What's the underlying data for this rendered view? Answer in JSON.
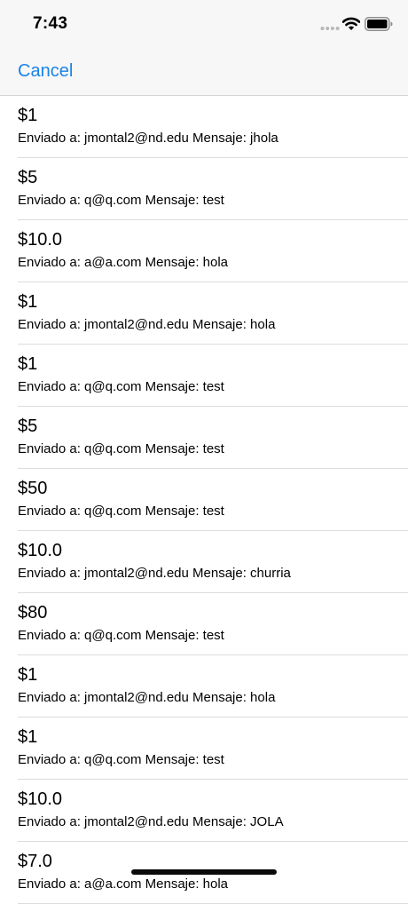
{
  "status_bar": {
    "time": "7:43",
    "icons": [
      "signal-dots-icon",
      "wifi-icon",
      "battery-icon"
    ]
  },
  "nav": {
    "cancel_label": "Cancel",
    "accent_color": "#1a82e8"
  },
  "payments": [
    {
      "amount": "$1",
      "detail": "Enviado a: jmontal2@nd.edu Mensaje: jhola"
    },
    {
      "amount": "$5",
      "detail": "Enviado a: q@q.com Mensaje: test"
    },
    {
      "amount": "$10.0",
      "detail": "Enviado a: a@a.com Mensaje: hola"
    },
    {
      "amount": "$1",
      "detail": "Enviado a: jmontal2@nd.edu Mensaje: hola"
    },
    {
      "amount": "$1",
      "detail": "Enviado a: q@q.com Mensaje: test"
    },
    {
      "amount": "$5",
      "detail": "Enviado a: q@q.com Mensaje: test"
    },
    {
      "amount": "$50",
      "detail": "Enviado a: q@q.com Mensaje: test"
    },
    {
      "amount": "$10.0",
      "detail": "Enviado a: jmontal2@nd.edu Mensaje: churria"
    },
    {
      "amount": "$80",
      "detail": "Enviado a: q@q.com Mensaje: test"
    },
    {
      "amount": "$1",
      "detail": "Enviado a: jmontal2@nd.edu Mensaje: hola"
    },
    {
      "amount": "$1",
      "detail": "Enviado a: q@q.com Mensaje: test"
    },
    {
      "amount": "$10.0",
      "detail": "Enviado a: jmontal2@nd.edu Mensaje: JOLA"
    },
    {
      "amount": "$7.0",
      "detail": "Enviado a: a@a.com Mensaje: hola"
    }
  ]
}
